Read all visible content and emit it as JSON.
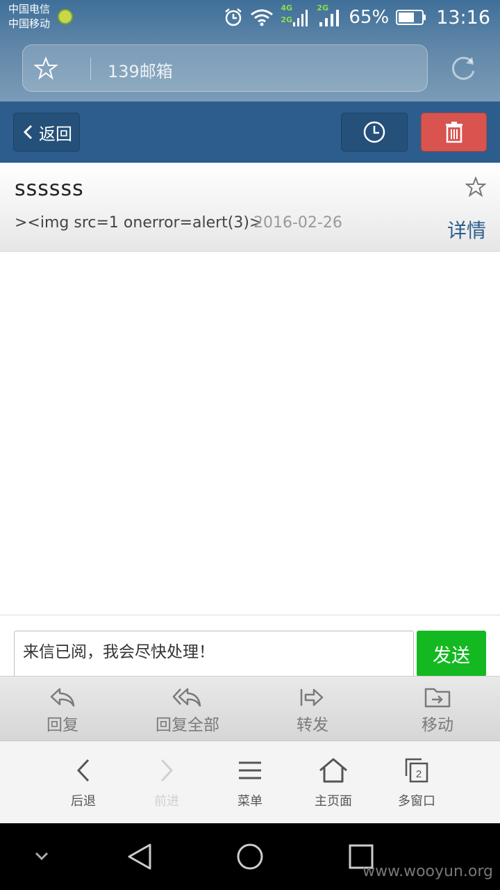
{
  "status_bar": {
    "carrier_1": "中国电信",
    "carrier_2": "中国移动",
    "net_4g": "4G",
    "net_2g_a": "2G",
    "net_2g_b": "2G",
    "battery": "65%",
    "time": "13:16"
  },
  "address_bar": {
    "title": "139邮箱",
    "star_icon": "star-outline-icon",
    "refresh_icon": "refresh-icon"
  },
  "toolbar": {
    "back_label": "返回",
    "clock_icon": "clock-icon",
    "delete_icon": "trash-icon",
    "delete_color": "#d9534f"
  },
  "mail": {
    "subject": "ssssss",
    "sender": "><img src=1 onerror=alert(3)>",
    "date": "2016-02-26",
    "detail_label": "详情"
  },
  "quick_reply": {
    "text": "来信已阅，我会尽快处理！",
    "send_label": "发送",
    "send_color": "#14b922"
  },
  "mail_actions": [
    {
      "label": "回复",
      "icon": "reply-icon"
    },
    {
      "label": "回复全部",
      "icon": "reply-all-icon"
    },
    {
      "label": "转发",
      "icon": "forward-icon"
    },
    {
      "label": "移动",
      "icon": "move-folder-icon"
    }
  ],
  "browser_nav": [
    {
      "label": "后退",
      "icon": "back-arrow-icon"
    },
    {
      "label": "前进",
      "icon": "forward-arrow-icon",
      "disabled": true
    },
    {
      "label": "菜单",
      "icon": "menu-icon"
    },
    {
      "label": "主页面",
      "icon": "home-icon"
    },
    {
      "label": "多窗口",
      "icon": "windows-icon",
      "count": "2"
    }
  ],
  "watermark": "www.wooyun.org"
}
